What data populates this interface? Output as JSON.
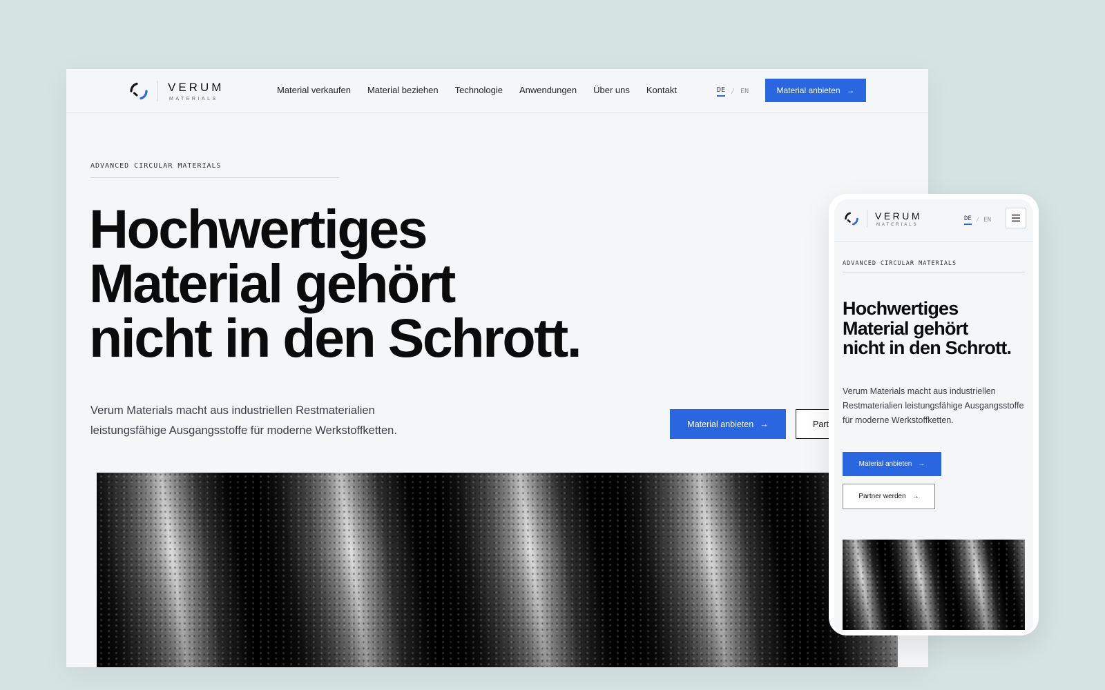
{
  "brand": {
    "name": "VERUM",
    "sub": "MATERIALS"
  },
  "nav": {
    "links": [
      "Material verkaufen",
      "Material beziehen",
      "Technologie",
      "Anwendungen",
      "Über uns",
      "Kontakt"
    ],
    "lang": {
      "de": "DE",
      "separator": "/",
      "en": "EN",
      "active": "DE"
    },
    "cta": "Material anbieten"
  },
  "hero": {
    "eyebrow": "ADVANCED CIRCULAR MATERIALS",
    "headline_lines": [
      "Hochwertiges",
      "Material gehört",
      "nicht in den Schrott."
    ],
    "lede": "Verum Materials macht aus industriellen Restmaterialien leistungsfähige Ausgangsstoffe für moderne Werkstoffketten.",
    "primary_cta": "Material anbieten",
    "secondary_cta": "Partner werden"
  },
  "icons": {
    "arrow": "→",
    "menu": "hamburger-icon",
    "logo": "circular-arc-logo-icon"
  },
  "colors": {
    "background": "#d6e3e3",
    "page": "#f4f6f8",
    "accent": "#2a66e0",
    "text": "#0b0b0b"
  }
}
